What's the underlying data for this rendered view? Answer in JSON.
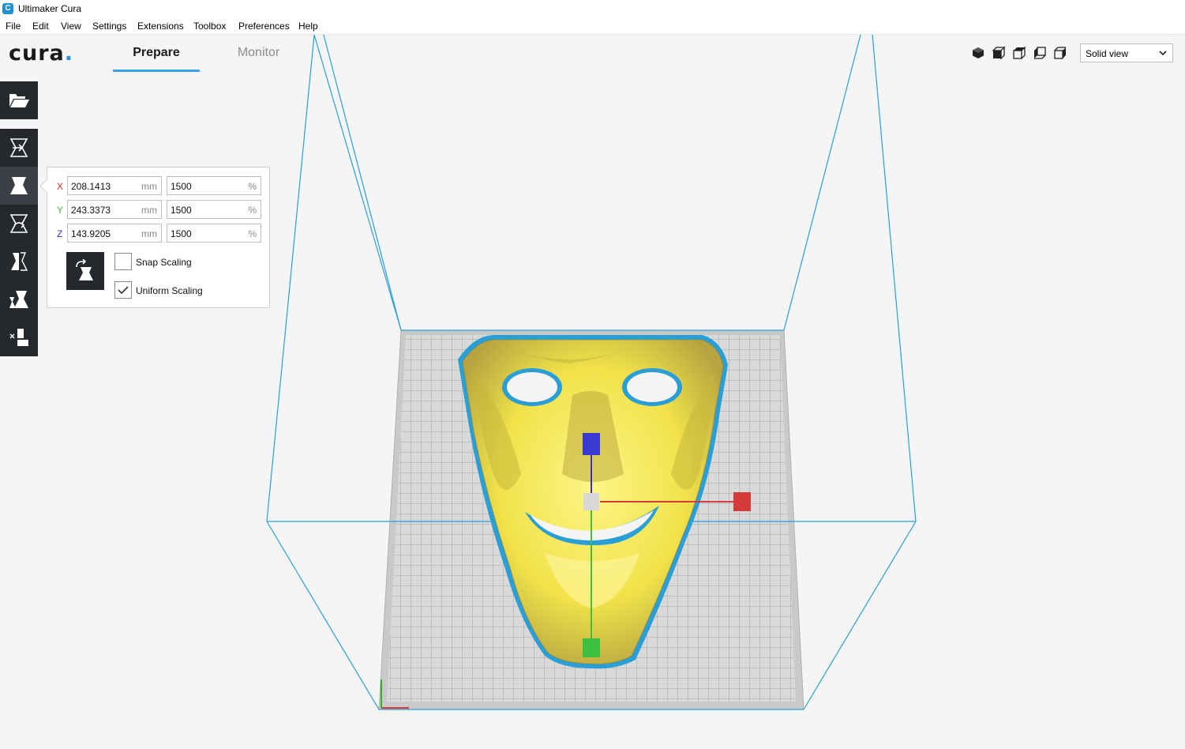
{
  "window": {
    "title": "Ultimaker Cura",
    "app_icon": "cura-app-icon"
  },
  "menu": [
    "File",
    "Edit",
    "View",
    "Settings",
    "Extensions",
    "Toolbox",
    "Preferences",
    "Help"
  ],
  "header": {
    "logo": "cura",
    "logo_dot": ".",
    "tabs": [
      {
        "label": "Prepare",
        "active": true
      },
      {
        "label": "Monitor",
        "active": false
      }
    ],
    "view_icons": [
      "3d-view-icon",
      "front-view-icon",
      "top-view-icon",
      "left-view-icon",
      "right-view-icon"
    ],
    "view_mode": "Solid view"
  },
  "toolbar": {
    "open_icon": "folder-open-icon",
    "tools": [
      {
        "name": "move-tool",
        "icon": "move-icon",
        "active": false
      },
      {
        "name": "scale-tool",
        "icon": "scale-icon",
        "active": true
      },
      {
        "name": "rotate-tool",
        "icon": "rotate-icon",
        "active": false
      },
      {
        "name": "mirror-tool",
        "icon": "mirror-icon",
        "active": false
      },
      {
        "name": "per-model-settings-tool",
        "icon": "per-model-settings-icon",
        "active": false
      },
      {
        "name": "support-blocker-tool",
        "icon": "support-blocker-icon",
        "active": false
      }
    ]
  },
  "scale_panel": {
    "rows": [
      {
        "axis": "X",
        "mm": "208.1413",
        "percent": "1500",
        "color": "#d62f2f"
      },
      {
        "axis": "Y",
        "mm": "243.3373",
        "percent": "1500",
        "color": "#3fbf3f"
      },
      {
        "axis": "Z",
        "mm": "143.9205",
        "percent": "1500",
        "color": "#3333cc"
      }
    ],
    "mm_unit": "mm",
    "percent_unit": "%",
    "snap_scaling": {
      "label": "Snap Scaling",
      "checked": false
    },
    "uniform_scaling": {
      "label": "Uniform Scaling",
      "checked": true
    },
    "reset_icon": "reset-scale-icon"
  },
  "colors": {
    "toolbar_bg": "#25292e",
    "accent": "#3aa0e6",
    "build_volume": "#2a9fd6",
    "model_fill": "#f5ea5a",
    "model_outline": "#2a9fd6"
  }
}
